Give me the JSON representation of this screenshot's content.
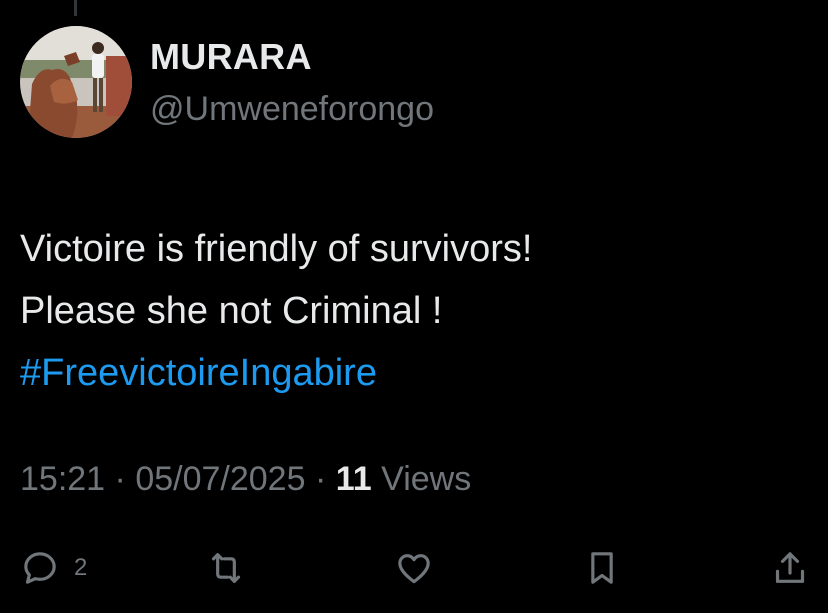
{
  "post": {
    "display_name": "MURARA",
    "handle": "@Umweneforongo",
    "text_lines": [
      "Victoire is friendly of survivors!",
      "Please she not Criminal !"
    ],
    "hashtag": "#FreevictoireIngabire",
    "time": "15:21",
    "separator": "·",
    "date": "05/07/2025",
    "views_count": "11",
    "views_label": "Views"
  },
  "actions": {
    "reply_icon": "reply-icon",
    "reply_count": "2",
    "repost_icon": "repost-icon",
    "like_icon": "heart-icon",
    "bookmark_icon": "bookmark-icon",
    "share_icon": "share-icon"
  },
  "colors": {
    "background": "#000000",
    "primary_text": "#e7e9ea",
    "secondary_text": "#71767b",
    "hashtag": "#1d9bf0",
    "thread_line": "#333639"
  }
}
